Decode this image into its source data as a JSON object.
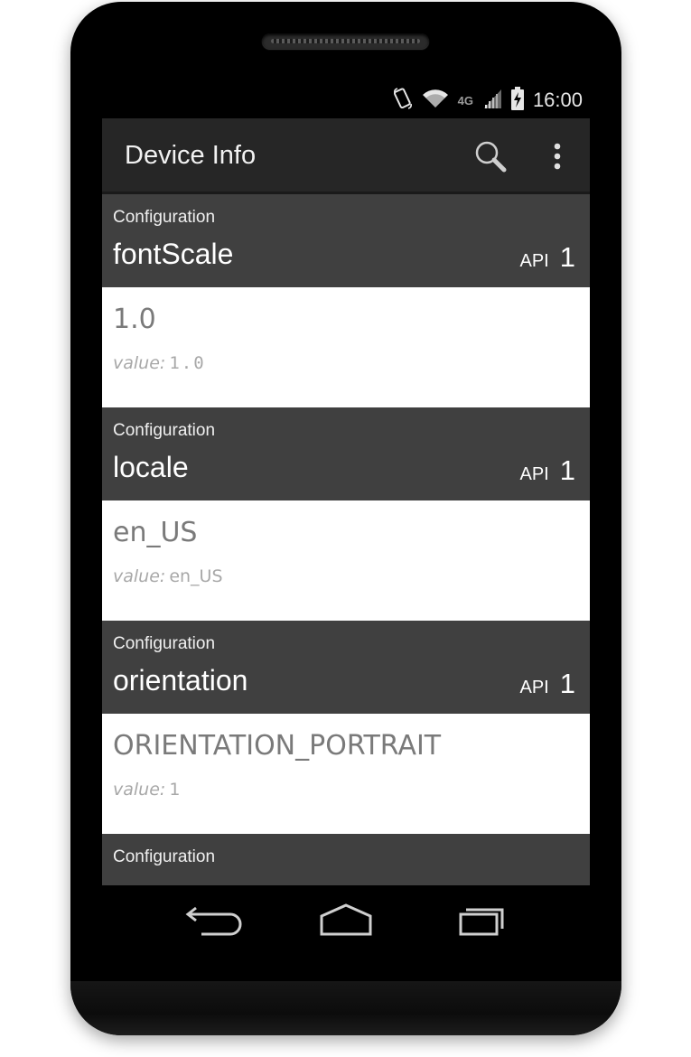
{
  "status_bar": {
    "time": "16:00",
    "network": "4G",
    "icons": [
      "rotate-icon",
      "wifi-icon",
      "network-4g-lte-icon",
      "signal-icon",
      "battery-charging-icon"
    ]
  },
  "action_bar": {
    "title": "Device Info",
    "search_icon": "search-icon",
    "overflow_icon": "overflow-menu-icon"
  },
  "items": [
    {
      "category": "Configuration",
      "name": "fontScale",
      "api_label": "API",
      "api_level": "1",
      "display_value": "1.0",
      "value_label": "value:",
      "value": "1.0"
    },
    {
      "category": "Configuration",
      "name": "locale",
      "api_label": "API",
      "api_level": "1",
      "display_value": "en_US",
      "value_label": "value:",
      "value": "en_US"
    },
    {
      "category": "Configuration",
      "name": "orientation",
      "api_label": "API",
      "api_level": "1",
      "display_value": "ORIENTATION_PORTRAIT",
      "value_label": "value:",
      "value": "1"
    },
    {
      "category": "Configuration"
    }
  ],
  "nav_bar": {
    "back_icon": "back-icon",
    "home_icon": "home-icon",
    "recents_icon": "recent-apps-icon"
  },
  "colors": {
    "action_bar": "#262626",
    "item_header": "#404040",
    "item_body": "#ffffff",
    "display_text": "#7a7a7a",
    "value_text": "#a8a8a8"
  }
}
